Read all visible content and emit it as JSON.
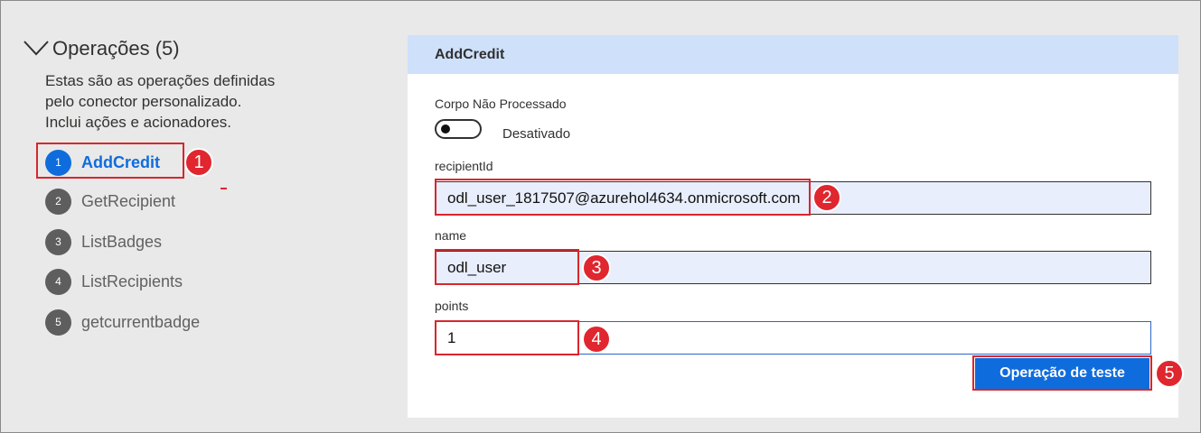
{
  "operations": {
    "title": "Operações (5)",
    "description_lines": [
      "Estas são as operações definidas",
      "pelo conector personalizado.",
      "Inclui ações e acionadores."
    ],
    "items": [
      {
        "number": "1",
        "label": "AddCredit",
        "active": true
      },
      {
        "number": "2",
        "label": "GetRecipient",
        "active": false
      },
      {
        "number": "3",
        "label": "ListBadges",
        "active": false
      },
      {
        "number": "4",
        "label": "ListRecipients",
        "active": false
      },
      {
        "number": "5",
        "label": "getcurrentbadge",
        "active": false
      }
    ]
  },
  "panel": {
    "title": "AddCredit",
    "raw_body": {
      "label": "Corpo Não Processado",
      "state": "Desativado"
    },
    "fields": [
      {
        "label": "recipientId",
        "value": "odl_user_1817507@azurehol4634.onmicrosoft.com"
      },
      {
        "label": "name",
        "value": "odl_user"
      },
      {
        "label": "points",
        "value": "1"
      }
    ],
    "test_button": "Operação de teste"
  },
  "callouts": [
    "1",
    "2",
    "3",
    "4",
    "5"
  ],
  "colors": {
    "accent": "#0f6cdc",
    "highlight": "#d8262c",
    "panel_header": "#cfe1fa",
    "filled_input": "#e8eefb"
  }
}
